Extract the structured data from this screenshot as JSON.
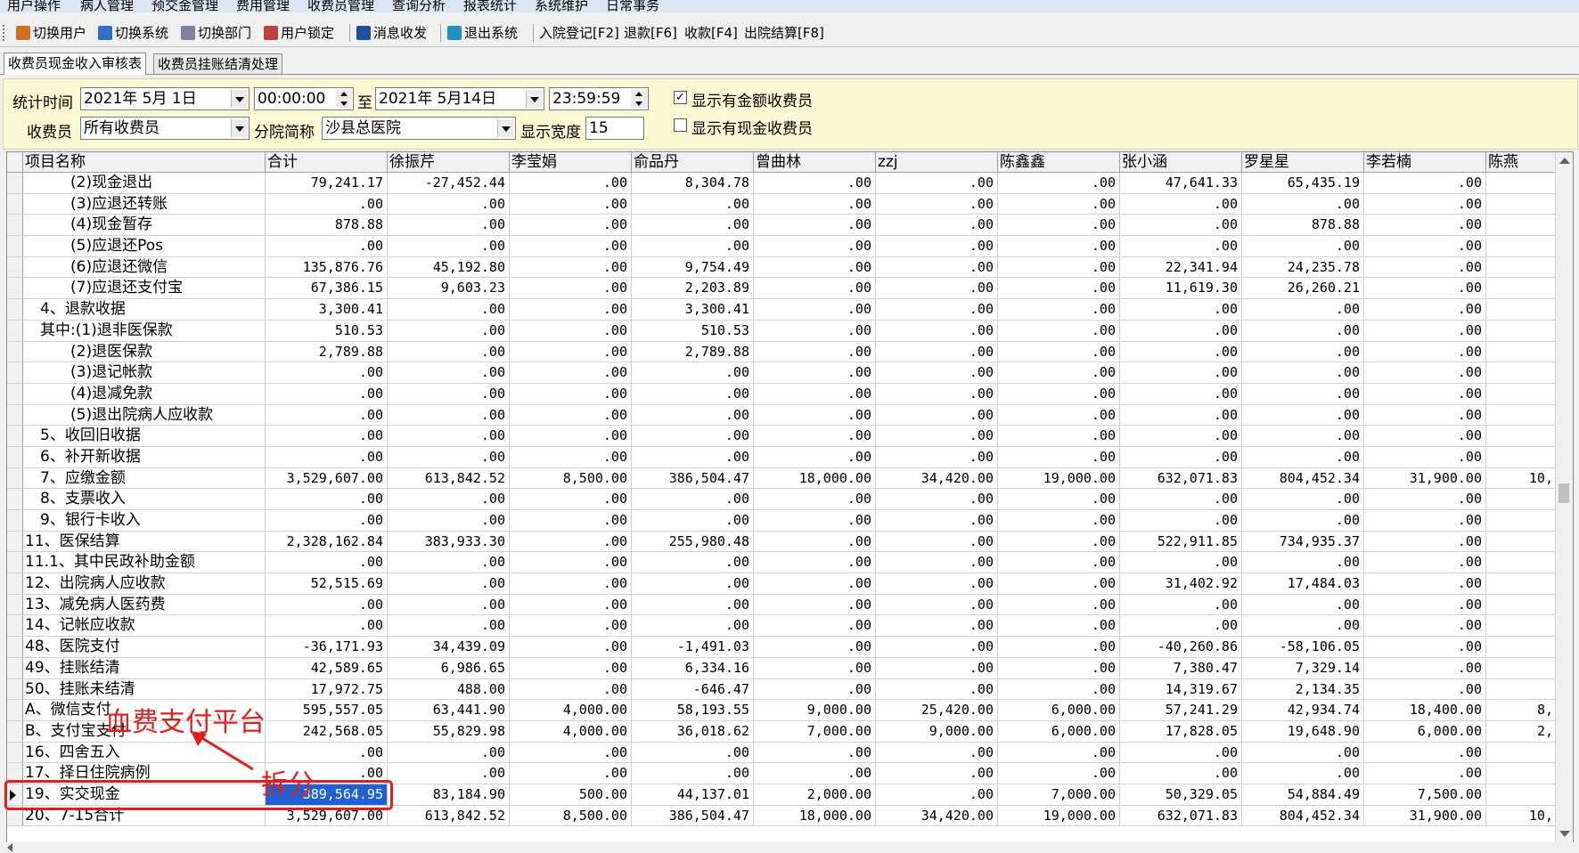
{
  "menu": [
    "用户操作",
    "病人管理",
    "预交金管理",
    "费用管理",
    "收费员管理",
    "查询分析",
    "报表统计",
    "系统维护",
    "日常事务"
  ],
  "toolbar": [
    {
      "label": "切换用户",
      "icon": "users-icon",
      "color": "#d07020"
    },
    {
      "label": "切换系统",
      "icon": "switch-icon",
      "color": "#3070c0"
    },
    {
      "label": "切换部门",
      "icon": "department-icon",
      "color": "#8080a0"
    },
    {
      "label": "用户锁定",
      "icon": "user-lock-icon",
      "color": "#c04040"
    },
    {
      "label": "消息收发",
      "icon": "info-icon",
      "color": "#2050a0"
    },
    {
      "label": "退出系统",
      "icon": "exit-icon",
      "color": "#2090c0"
    },
    {
      "label": "入院登记[F2]"
    },
    {
      "label": "退款[F6]"
    },
    {
      "label": "收款[F4]"
    },
    {
      "label": "出院结算[F8]"
    }
  ],
  "tabs": [
    {
      "label": "收费员现金收入审核表",
      "active": true
    },
    {
      "label": "收费员挂账结清处理",
      "active": false
    }
  ],
  "filters": {
    "time_label": "统计时间",
    "start_date": "2021年 5月 1日",
    "start_time": "00:00:00",
    "to_label": "至",
    "end_date": "2021年 5月14日",
    "end_time": "23:59:59",
    "cashier_label": "收费员",
    "cashier_value": "所有收费员",
    "branch_label": "分院简称",
    "branch_value": "沙县总医院",
    "width_label": "显示宽度",
    "width_value": "15",
    "show_amount_label": "显示有金额收费员",
    "show_amount_checked": "✓",
    "show_cash_label": "显示有现金收费员",
    "show_cash_checked": ""
  },
  "columns": [
    "项目名称",
    "合计",
    "徐振芹",
    "李莹娟",
    "俞品丹",
    "曾曲林",
    "zzj",
    "陈鑫鑫",
    "张小涵",
    "罗星星",
    "李若楠",
    "陈燕"
  ],
  "rows": [
    [
      "　　　(2)现金退出",
      "79,241.17",
      "-27,452.44",
      ".00",
      "8,304.78",
      ".00",
      ".00",
      ".00",
      "47,641.33",
      "65,435.19",
      ".00",
      ""
    ],
    [
      "　　　(3)应退还转账",
      ".00",
      ".00",
      ".00",
      ".00",
      ".00",
      ".00",
      ".00",
      ".00",
      ".00",
      ".00",
      ""
    ],
    [
      "　　　(4)现金暂存",
      "878.88",
      ".00",
      ".00",
      ".00",
      ".00",
      ".00",
      ".00",
      ".00",
      "878.88",
      ".00",
      ""
    ],
    [
      "　　　(5)应退还Pos",
      ".00",
      ".00",
      ".00",
      ".00",
      ".00",
      ".00",
      ".00",
      ".00",
      ".00",
      ".00",
      ""
    ],
    [
      "　　　(6)应退还微信",
      "135,876.76",
      "45,192.80",
      ".00",
      "9,754.49",
      ".00",
      ".00",
      ".00",
      "22,341.94",
      "24,235.78",
      ".00",
      ""
    ],
    [
      "　　　(7)应退还支付宝",
      "67,386.15",
      "9,603.23",
      ".00",
      "2,203.89",
      ".00",
      ".00",
      ".00",
      "11,619.30",
      "26,260.21",
      ".00",
      ""
    ],
    [
      "　4、退款收据",
      "3,300.41",
      ".00",
      ".00",
      "3,300.41",
      ".00",
      ".00",
      ".00",
      ".00",
      ".00",
      ".00",
      ""
    ],
    [
      "　其中:(1)退非医保款",
      "510.53",
      ".00",
      ".00",
      "510.53",
      ".00",
      ".00",
      ".00",
      ".00",
      ".00",
      ".00",
      ""
    ],
    [
      "　　　(2)退医保款",
      "2,789.88",
      ".00",
      ".00",
      "2,789.88",
      ".00",
      ".00",
      ".00",
      ".00",
      ".00",
      ".00",
      ""
    ],
    [
      "　　　(3)退记帐款",
      ".00",
      ".00",
      ".00",
      ".00",
      ".00",
      ".00",
      ".00",
      ".00",
      ".00",
      ".00",
      ""
    ],
    [
      "　　　(4)退减免款",
      ".00",
      ".00",
      ".00",
      ".00",
      ".00",
      ".00",
      ".00",
      ".00",
      ".00",
      ".00",
      ""
    ],
    [
      "　　　(5)退出院病人应收款",
      ".00",
      ".00",
      ".00",
      ".00",
      ".00",
      ".00",
      ".00",
      ".00",
      ".00",
      ".00",
      ""
    ],
    [
      "　5、收回旧收据",
      ".00",
      ".00",
      ".00",
      ".00",
      ".00",
      ".00",
      ".00",
      ".00",
      ".00",
      ".00",
      ""
    ],
    [
      "　6、补开新收据",
      ".00",
      ".00",
      ".00",
      ".00",
      ".00",
      ".00",
      ".00",
      ".00",
      ".00",
      ".00",
      ""
    ],
    [
      "　7、应缴金额",
      "3,529,607.00",
      "613,842.52",
      "8,500.00",
      "386,504.47",
      "18,000.00",
      "34,420.00",
      "19,000.00",
      "632,071.83",
      "804,452.34",
      "31,900.00",
      "10,"
    ],
    [
      "　8、支票收入",
      ".00",
      ".00",
      ".00",
      ".00",
      ".00",
      ".00",
      ".00",
      ".00",
      ".00",
      ".00",
      ""
    ],
    [
      "　9、银行卡收入",
      ".00",
      ".00",
      ".00",
      ".00",
      ".00",
      ".00",
      ".00",
      ".00",
      ".00",
      ".00",
      ""
    ],
    [
      "11、医保结算",
      "2,328,162.84",
      "383,933.30",
      ".00",
      "255,980.48",
      ".00",
      ".00",
      ".00",
      "522,911.85",
      "734,935.37",
      ".00",
      ""
    ],
    [
      "11.1、其中民政补助金额",
      ".00",
      ".00",
      ".00",
      ".00",
      ".00",
      ".00",
      ".00",
      ".00",
      ".00",
      ".00",
      ""
    ],
    [
      "12、出院病人应收款",
      "52,515.69",
      ".00",
      ".00",
      ".00",
      ".00",
      ".00",
      ".00",
      "31,402.92",
      "17,484.03",
      ".00",
      ""
    ],
    [
      "13、减免病人医药费",
      ".00",
      ".00",
      ".00",
      ".00",
      ".00",
      ".00",
      ".00",
      ".00",
      ".00",
      ".00",
      ""
    ],
    [
      "14、记帐应收款",
      ".00",
      ".00",
      ".00",
      ".00",
      ".00",
      ".00",
      ".00",
      ".00",
      ".00",
      ".00",
      ""
    ],
    [
      "48、医院支付",
      "-36,171.93",
      "34,439.09",
      ".00",
      "-1,491.03",
      ".00",
      ".00",
      ".00",
      "-40,260.86",
      "-58,106.05",
      ".00",
      ""
    ],
    [
      "49、挂账结清",
      "42,589.65",
      "6,986.65",
      ".00",
      "6,334.16",
      ".00",
      ".00",
      ".00",
      "7,380.47",
      "7,329.14",
      ".00",
      ""
    ],
    [
      "50、挂账未结清",
      "17,972.75",
      "488.00",
      ".00",
      "-646.47",
      ".00",
      ".00",
      ".00",
      "14,319.67",
      "2,134.35",
      ".00",
      ""
    ],
    [
      "A、微信支付",
      "595,557.05",
      "63,441.90",
      "4,000.00",
      "58,193.55",
      "9,000.00",
      "25,420.00",
      "6,000.00",
      "57,241.29",
      "42,934.74",
      "18,400.00",
      "8,"
    ],
    [
      "B、支付宝支付",
      "242,568.05",
      "55,829.98",
      "4,000.00",
      "36,018.62",
      "7,000.00",
      "9,000.00",
      "6,000.00",
      "17,828.05",
      "19,648.90",
      "6,000.00",
      "2,"
    ],
    [
      "16、四舍五入",
      ".00",
      ".00",
      ".00",
      ".00",
      ".00",
      ".00",
      ".00",
      ".00",
      ".00",
      ".00",
      ""
    ],
    [
      "17、择日住院病例",
      ".00",
      ".00",
      ".00",
      ".00",
      ".00",
      ".00",
      ".00",
      ".00",
      ".00",
      ".00",
      ""
    ],
    [
      "19、实交现金",
      "389,564.95",
      "83,184.90",
      "500.00",
      "44,137.01",
      "2,000.00",
      ".00",
      "7,000.00",
      "50,329.05",
      "54,884.49",
      "7,500.00",
      ""
    ],
    [
      "20、7-15合计",
      "3,529,607.00",
      "613,842.52",
      "8,500.00",
      "386,504.47",
      "18,000.00",
      "34,420.00",
      "19,000.00",
      "632,071.83",
      "804,452.34",
      "31,900.00",
      "10,"
    ]
  ],
  "annotations": {
    "platform_text": "血费支付平台",
    "split_text": "拆分",
    "color": "#e02020"
  }
}
